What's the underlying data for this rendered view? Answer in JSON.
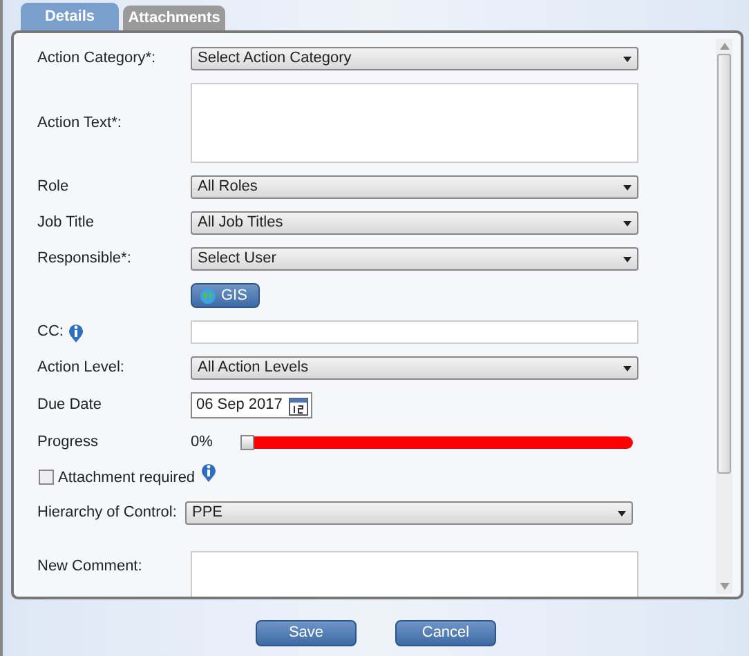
{
  "tabs": [
    {
      "label": "Details",
      "selected": true
    },
    {
      "label": "Attachments",
      "selected": false
    }
  ],
  "fields": [
    {
      "kind": "select",
      "label": "Action Category*:",
      "value": "Select Action Category"
    },
    {
      "kind": "textarea",
      "label": "Action Text*:"
    },
    {
      "kind": "select",
      "label": "Role",
      "value": "All Roles"
    },
    {
      "kind": "select",
      "label": "Job Title",
      "value": "All Job Titles"
    },
    {
      "kind": "select",
      "label": "Responsible*:",
      "value": "Select User"
    },
    {
      "kind": "button",
      "label": "GIS"
    },
    {
      "kind": "text",
      "label": "CC:",
      "info": true
    },
    {
      "kind": "select",
      "label": "Action Level:",
      "value": "All Action Levels"
    },
    {
      "kind": "date",
      "label": "Due Date",
      "value": "06 Sep 2017"
    },
    {
      "kind": "progress",
      "label": "Progress",
      "reading": "0%",
      "level": 0
    },
    {
      "kind": "checkbox",
      "label": "Attachment required",
      "checked": false,
      "info": true
    },
    {
      "kind": "select",
      "label": "Hierarchy of Control:",
      "value": "PPE"
    },
    {
      "kind": "textarea",
      "label": "New Comment:"
    }
  ],
  "buttons": [
    "Save",
    "Cancel"
  ]
}
